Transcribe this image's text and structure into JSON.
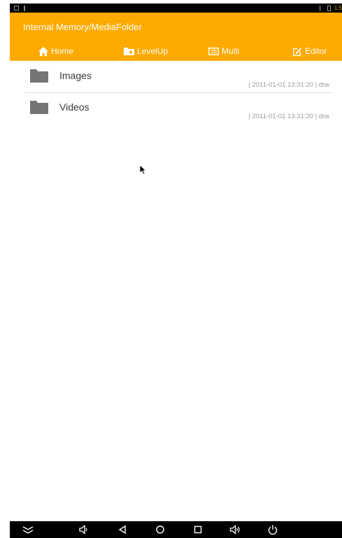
{
  "status_bar": {
    "time": "1:5"
  },
  "header": {
    "path": "Internal Memory/MediaFolder",
    "toolbar": [
      {
        "label": "Home",
        "icon": "home-icon"
      },
      {
        "label": "LevelUp",
        "icon": "folder-up-icon"
      },
      {
        "label": "Multi",
        "icon": "multi-select-icon"
      },
      {
        "label": "Editor",
        "icon": "edit-icon"
      }
    ]
  },
  "files": [
    {
      "name": "Images",
      "meta": "| 2011-01-01 13:31:20 | drw",
      "icon": "folder-icon"
    },
    {
      "name": "Videos",
      "meta": "| 2011-01-01 13:31:20 | drw",
      "icon": "folder-icon"
    }
  ],
  "navbar": [
    {
      "icon": "collapse-icon"
    },
    {
      "icon": "volume-down-icon"
    },
    {
      "icon": "back-icon"
    },
    {
      "icon": "home-circle-icon"
    },
    {
      "icon": "recents-icon"
    },
    {
      "icon": "volume-up-icon"
    },
    {
      "icon": "power-icon"
    }
  ],
  "colors": {
    "accent": "#ffaa00",
    "status_bar": "#000000",
    "nav_bar": "#000000"
  }
}
